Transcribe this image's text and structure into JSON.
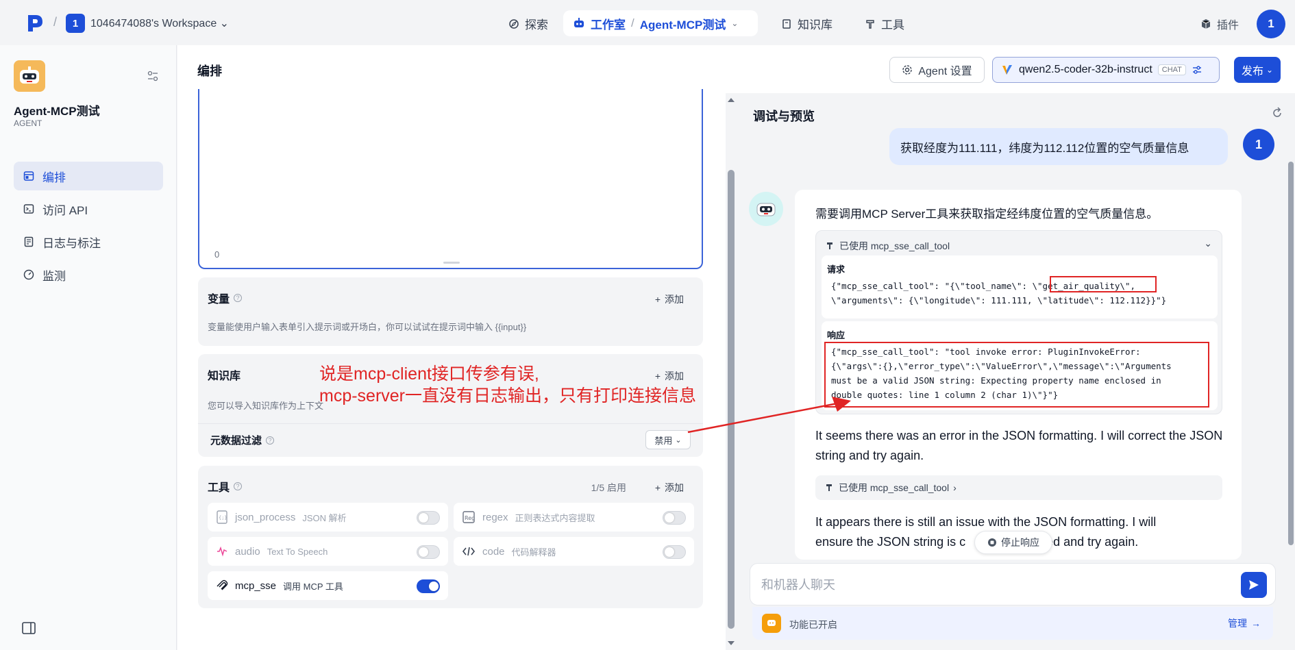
{
  "topbar": {
    "workspace_badge": "1",
    "workspace_name": "1046474088's Workspace",
    "nav": {
      "explore": "探索",
      "studio": "工作室",
      "agent_name": "Agent-MCP测试",
      "knowledge": "知识库",
      "tools": "工具"
    },
    "plugin": "插件",
    "user_initial": "1"
  },
  "sidebar": {
    "agent_title": "Agent-MCP测试",
    "agent_type": "AGENT",
    "items": [
      {
        "label": "编排",
        "icon": "layout-icon"
      },
      {
        "label": "访问 API",
        "icon": "terminal-icon"
      },
      {
        "label": "日志与标注",
        "icon": "log-icon"
      },
      {
        "label": "监测",
        "icon": "gauge-icon"
      }
    ]
  },
  "header": {
    "title": "编排",
    "agent_settings": "Agent 设置",
    "model_name": "qwen2.5-coder-32b-instruct",
    "model_tag": "CHAT",
    "publish": "发布"
  },
  "prompt": {
    "count": "0"
  },
  "variables": {
    "title": "变量",
    "add": "添加",
    "desc": "变量能使用户输入表单引入提示词或开场白，你可以试试在提示词中输入 {{input}}"
  },
  "knowledge": {
    "title": "知识库",
    "add": "添加",
    "desc": "您可以导入知识库作为上下文",
    "metadata_filter": "元数据过滤",
    "metadata_value": "禁用"
  },
  "tools": {
    "title": "工具",
    "enabled_count": "1/5 启用",
    "add": "添加",
    "items": [
      {
        "name": "json_process",
        "sub": "JSON 解析",
        "on": false
      },
      {
        "name": "regex",
        "sub": "正则表达式内容提取",
        "on": false
      },
      {
        "name": "audio",
        "sub": "Text To Speech",
        "on": false
      },
      {
        "name": "code",
        "sub": "代码解释器",
        "on": false
      },
      {
        "name": "mcp_sse",
        "sub": "调用 MCP 工具",
        "on": true
      }
    ]
  },
  "annotation": {
    "line1": "说是mcp-client接口传参有误,",
    "line2": "mcp-server一直没有日志输出，只有打印连接信息"
  },
  "debug": {
    "title": "调试与预览",
    "user_message": "获取经度为111.111，纬度为112.112位置的空气质量信息",
    "user_initial": "1",
    "bot_intro": "需要调用MCP Server工具来获取指定经纬度位置的空气质量信息。",
    "tool_used": "已使用 mcp_sse_call_tool",
    "request_label": "请求",
    "request_line1": "{\"mcp_sse_call_tool\": \"{\\\"tool_name\\\": \\\"get_air_quality\\\",",
    "request_line2": "\\\"arguments\\\": {\\\"longitude\\\": 111.111, \\\"latitude\\\": 112.112}}\"}",
    "response_label": "响应",
    "response_line1": "{\"mcp_sse_call_tool\": \"tool invoke error: PluginInvokeError:",
    "response_line2": "{\\\"args\\\":{},\\\"error_type\\\":\\\"ValueError\\\",\\\"message\\\":\\\"Arguments",
    "response_line3": "must be a valid JSON string: Expecting property name enclosed in",
    "response_line4": "double quotes: line 1 column 2 (char 1)\\\"}\"}",
    "bot_text2": "It seems there was an error in the JSON formatting. I will correct the JSON string and try again.",
    "tool_used2": "已使用 mcp_sse_call_tool",
    "bot_text3_part1": "It appears there is still an issue with the JSON formatting. I will",
    "bot_text3_part2": "ensure the JSON string is c",
    "bot_text3_part3": "atted and try again.",
    "stop": "停止响应",
    "input_placeholder": "和机器人聊天",
    "feature_text": "功能已开启",
    "manage": "管理"
  },
  "colors": {
    "accent": "#1d4ed8",
    "annotation": "#e02424"
  }
}
